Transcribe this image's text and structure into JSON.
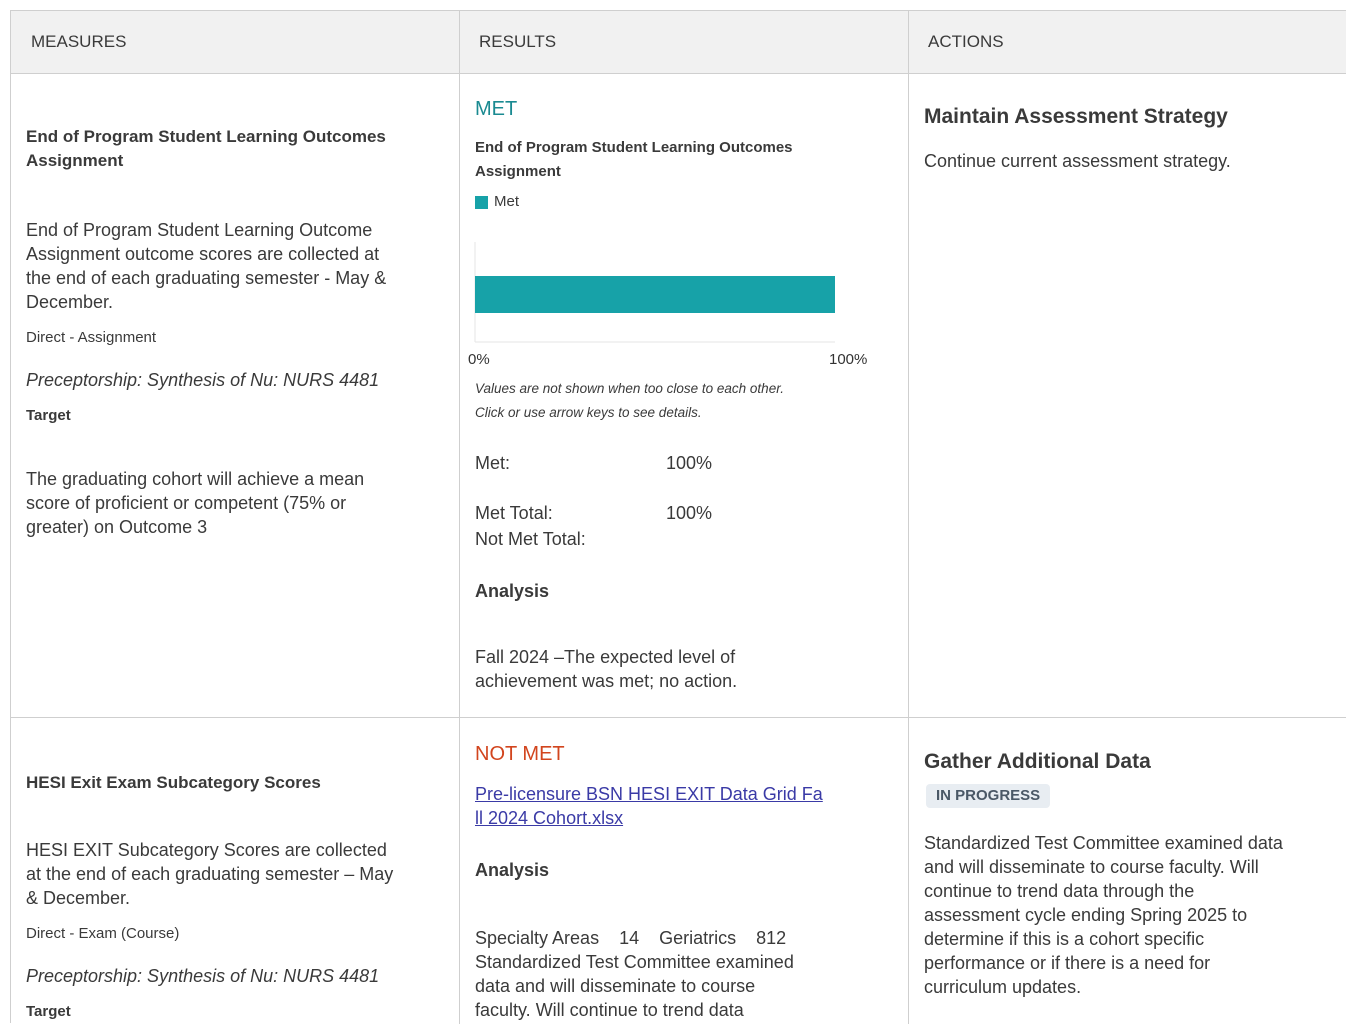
{
  "header": {
    "measures": "MEASURES",
    "results": "RESULTS",
    "actions": "ACTIONS"
  },
  "colors": {
    "met": "#1a8a91",
    "not_met": "#d2451e",
    "bar": "#17a2a8",
    "link": "#3a3aa6"
  },
  "rows": [
    {
      "measure": {
        "title_l1": "End of Program Student Learning Outcomes",
        "title_l2": "Assignment",
        "desc_l1": "End of Program Student Learning Outcome",
        "desc_l2": "Assignment outcome scores are collected at",
        "desc_l3": "the end of each graduating semester - May &",
        "desc_l4": "December.",
        "method": "Direct - Assignment",
        "course": "Preceptorship: Synthesis of Nu: NURS 4481",
        "target_label": "Target",
        "target_l1": "The graduating cohort will achieve a mean",
        "target_l2": "score of proficient or competent (75% or",
        "target_l3": "greater) on Outcome 3"
      },
      "result": {
        "status": "MET",
        "chart_title_l1": "End of Program Student Learning Outcomes",
        "chart_title_l2": "Assignment",
        "legend": "Met",
        "axis_min": "0%",
        "axis_max": "100%",
        "note_l1": "Values are not shown when too close to each other.",
        "note_l2": "Click or use arrow keys to see details.",
        "met_label": "Met:",
        "met_value": "100%",
        "met_total_label": "Met Total:",
        "met_total_value": "100%",
        "not_met_total_label": "Not Met Total:",
        "analysis_label": "Analysis",
        "analysis_l1": "Fall 2024 –The expected level of",
        "analysis_l2": "achievement was met; no action."
      },
      "action": {
        "title": "Maintain Assessment Strategy",
        "text": "Continue current assessment strategy."
      }
    },
    {
      "measure": {
        "title": "HESI Exit Exam Subcategory Scores",
        "desc_l1": "HESI EXIT Subcategory Scores are collected",
        "desc_l2": "at the end of each graduating semester – May",
        "desc_l3": "& December.",
        "method": "Direct - Exam (Course)",
        "course": "Preceptorship: Synthesis of Nu: NURS 4481",
        "target_label": "Target"
      },
      "result": {
        "status": "NOT MET",
        "link_l1": "Pre-licensure BSN HESI EXIT Data Grid Fa",
        "link_l2": "ll 2024 Cohort.xlsx",
        "analysis_label": "Analysis",
        "analysis_l1": "Specialty Areas    14    Geriatrics    812",
        "analysis_l2": "Standardized Test Committee examined",
        "analysis_l3": "data and will disseminate to course",
        "analysis_l4": "faculty. Will continue to trend data"
      },
      "action": {
        "title": "Gather Additional Data",
        "badge": "IN PROGRESS",
        "text_l1": "Standardized Test Committee examined data",
        "text_l2": "and will disseminate to course faculty. Will",
        "text_l3": "continue to trend data through the",
        "text_l4": "assessment cycle ending Spring 2025 to",
        "text_l5": "determine if this is a cohort specific",
        "text_l6": "performance or if there is a need for",
        "text_l7": "curriculum updates."
      }
    }
  ],
  "chart_data": {
    "type": "bar",
    "orientation": "horizontal",
    "title": "End of Program Student Learning Outcomes Assignment",
    "categories": [
      "Met"
    ],
    "series": [
      {
        "name": "Met",
        "values": [
          100
        ]
      }
    ],
    "xlim": [
      0,
      100
    ],
    "unit": "%",
    "legend": "top-left"
  }
}
